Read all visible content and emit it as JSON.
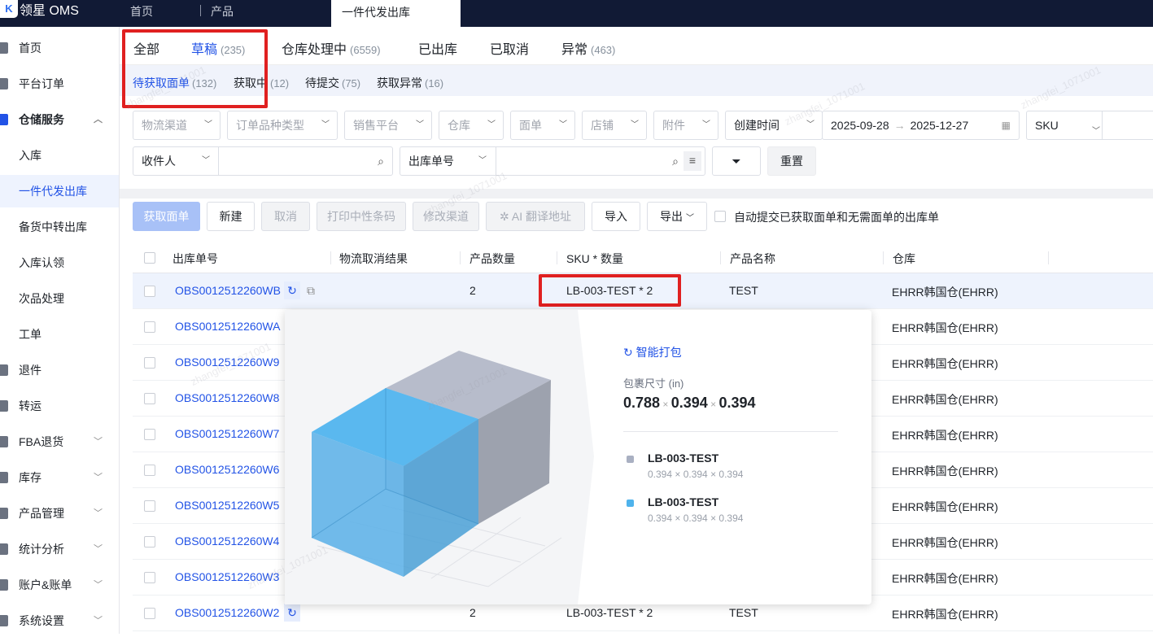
{
  "topbar": {
    "logo": "K",
    "brand": "领星 OMS",
    "nav": [
      "首页",
      "产品"
    ],
    "active_tab": "一件代发出库"
  },
  "sidebar": [
    {
      "label": "首页",
      "icon": "home-icon"
    },
    {
      "label": "平台订单",
      "icon": "clipboard-icon"
    },
    {
      "label": "仓储服务",
      "icon": "warehouse-icon",
      "expanded": true
    },
    {
      "label": "入库"
    },
    {
      "label": "一件代发出库",
      "active": true
    },
    {
      "label": "备货中转出库"
    },
    {
      "label": "入库认领"
    },
    {
      "label": "次品处理"
    },
    {
      "label": "工单"
    },
    {
      "label": "退件",
      "icon": "return-icon"
    },
    {
      "label": "转运",
      "icon": "transfer-icon"
    },
    {
      "label": "FBA退货",
      "icon": "fba-icon",
      "chevron": true
    },
    {
      "label": "库存",
      "icon": "inventory-icon",
      "chevron": true
    },
    {
      "label": "产品管理",
      "icon": "product-icon",
      "chevron": true
    },
    {
      "label": "统计分析",
      "icon": "chart-icon",
      "chevron": true
    },
    {
      "label": "账户&账单",
      "icon": "account-icon",
      "chevron": true
    },
    {
      "label": "系统设置",
      "icon": "settings-icon",
      "chevron": true
    }
  ],
  "tabs": [
    {
      "label": "全部",
      "count": ""
    },
    {
      "label": "草稿",
      "count": "(235)"
    },
    {
      "label": "仓库处理中",
      "count": "(6559)"
    },
    {
      "label": "已出库",
      "count": ""
    },
    {
      "label": "已取消",
      "count": ""
    },
    {
      "label": "异常",
      "count": "(463)"
    }
  ],
  "subtabs": [
    {
      "label": "待获取面单",
      "count": "(132)"
    },
    {
      "label": "获取中",
      "count": "(12)"
    },
    {
      "label": "待提交",
      "count": "(75)"
    },
    {
      "label": "获取异常",
      "count": "(16)"
    }
  ],
  "filters": {
    "row1": [
      "物流渠道",
      "订单品种类型",
      "销售平台",
      "仓库",
      "面单",
      "店铺",
      "附件"
    ],
    "date_type": "创建时间",
    "date_start": "2025-09-28",
    "date_end": "2025-12-27",
    "sku": "SKU",
    "recipient": "收件人",
    "order_no": "出库单号",
    "reset": "重置"
  },
  "toolbar": {
    "fetch": "获取面单",
    "new": "新建",
    "cancel": "取消",
    "print": "打印中性条码",
    "modify": "修改渠道",
    "ai": "AI 翻译地址",
    "import": "导入",
    "export": "导出",
    "auto_submit": "自动提交已获取面单和无需面单的出库单"
  },
  "table": {
    "headers": [
      "出库单号",
      "物流取消结果",
      "产品数量",
      "SKU * 数量",
      "产品名称",
      "仓库"
    ],
    "rows": [
      {
        "id": "OBS0012512260WB",
        "qty": "2",
        "sku": "LB-003-TEST * 2",
        "name": "TEST",
        "wh": "EHRR韩国仓(EHRR)"
      },
      {
        "id": "OBS0012512260WA",
        "wh": "EHRR韩国仓(EHRR)"
      },
      {
        "id": "OBS0012512260W9",
        "wh": "EHRR韩国仓(EHRR)"
      },
      {
        "id": "OBS0012512260W8",
        "wh": "EHRR韩国仓(EHRR)"
      },
      {
        "id": "OBS0012512260W7",
        "wh": "EHRR韩国仓(EHRR)"
      },
      {
        "id": "OBS0012512260W6",
        "wh": "EHRR韩国仓(EHRR)"
      },
      {
        "id": "OBS0012512260W5",
        "wh": "EHRR韩国仓(EHRR)"
      },
      {
        "id": "OBS0012512260W4",
        "wh": "EHRR韩国仓(EHRR)"
      },
      {
        "id": "OBS0012512260W3",
        "wh": "EHRR韩国仓(EHRR)"
      },
      {
        "id": "OBS0012512260W2",
        "qty": "2",
        "sku": "LB-003-TEST * 2",
        "name": "TEST",
        "wh": "EHRR韩国仓(EHRR)"
      }
    ]
  },
  "popover": {
    "title": "智能打包",
    "size_label": "包裹尺寸 (in)",
    "dims": [
      "0.788",
      "0.394",
      "0.394"
    ],
    "items": [
      {
        "name": "LB-003-TEST",
        "dims": "0.394 × 0.394 × 0.394",
        "color": "#a9b0c2"
      },
      {
        "name": "LB-003-TEST",
        "dims": "0.394 × 0.394 × 0.394",
        "color": "#4fb3ec"
      }
    ]
  },
  "watermark": "zhangfei_1071001"
}
